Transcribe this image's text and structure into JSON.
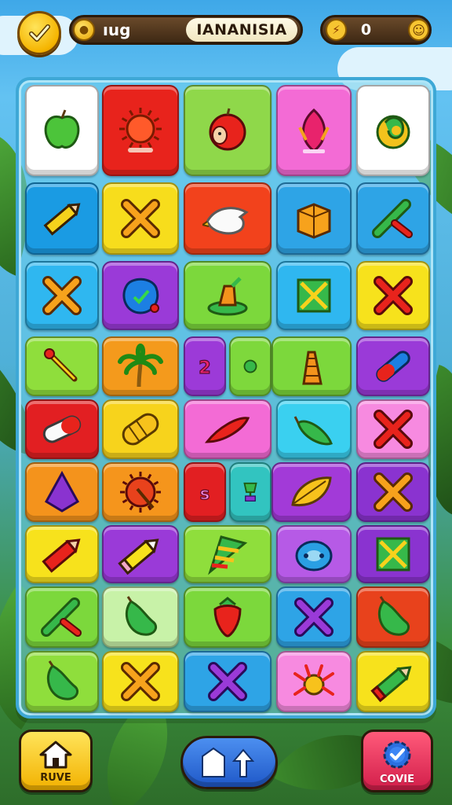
{
  "hud": {
    "level_text": "ıug",
    "title": "IANANISIA",
    "score": "0",
    "check_icon": "check-icon",
    "coin_icon": "coin-icon",
    "bolt_icon": "lightning-icon",
    "smile_icon": "smiley-icon"
  },
  "board": {
    "rows": [
      [
        {
          "icon": "green-apple",
          "color": "#ffffff"
        },
        {
          "icon": "red-sun-fruit",
          "color": "#e8231c"
        },
        {
          "icon": "red-apple-face",
          "color": "#8fd84a"
        },
        {
          "icon": "pink-leaf",
          "color": "#f36bd5"
        },
        {
          "icon": "green-yellow-fruit",
          "color": "#ffffff"
        }
      ],
      [
        {
          "icon": "yellow-pencil",
          "color": "#1a9be3"
        },
        {
          "icon": "orange-x",
          "color": "#f7dd1c"
        },
        {
          "icon": "white-bird",
          "color": "#f2421c"
        },
        {
          "icon": "orange-box",
          "color": "#2ea4e6"
        },
        {
          "icon": "green-red-pencil",
          "color": "#2ea4e6"
        }
      ],
      [
        {
          "icon": "orange-x",
          "color": "#2fb7f0"
        },
        {
          "icon": "blue-blob-check",
          "color": "#9a3ad8"
        },
        {
          "icon": "green-cup",
          "color": "#7cd83c"
        },
        {
          "icon": "green-x-square",
          "color": "#2fb7f0"
        },
        {
          "icon": "red-x",
          "color": "#f7e21c"
        }
      ],
      [
        {
          "icon": "matchstick",
          "color": "#8fde3c"
        },
        {
          "icon": "palm-tree",
          "color": "#f49a1c"
        },
        {
          "icon": "small-2",
          "color": "#9c3ad8",
          "small": true
        },
        {
          "icon": "green-dot",
          "color": "#7ed83c",
          "small": true
        },
        {
          "icon": "orange-cone",
          "color": "#7cd83c"
        },
        {
          "icon": "red-blue-capsule",
          "color": "#9a3ad8"
        }
      ],
      [
        {
          "icon": "white-capsule",
          "color": "#e21f22"
        },
        {
          "icon": "yellow-loaf",
          "color": "#f7d31c"
        },
        {
          "icon": "red-carrot",
          "color": "#f36bd5"
        },
        {
          "icon": "green-cucumber",
          "color": "#3ad0f0"
        },
        {
          "icon": "red-x",
          "color": "#f78ae0"
        }
      ],
      [
        {
          "icon": "purple-gem",
          "color": "#f4931c"
        },
        {
          "icon": "red-wheel",
          "color": "#f5951c"
        },
        {
          "icon": "pink-s",
          "color": "#e21f22",
          "small": true
        },
        {
          "icon": "green-trophy",
          "color": "#32c4c0",
          "small": true
        },
        {
          "icon": "yellow-leaf",
          "color": "#a23ad8"
        },
        {
          "icon": "orange-x",
          "color": "#8a33d0"
        }
      ],
      [
        {
          "icon": "red-pencil",
          "color": "#f7e21c"
        },
        {
          "icon": "white-pencil",
          "color": "#9a3ad8"
        },
        {
          "icon": "rainbow-wedge",
          "color": "#8fde3c"
        },
        {
          "icon": "blue-egg",
          "color": "#b65ae6"
        },
        {
          "icon": "green-x-square",
          "color": "#8a33d0"
        }
      ],
      [
        {
          "icon": "green-red-pencil",
          "color": "#7cd83c"
        },
        {
          "icon": "green-pepper",
          "color": "#c8f2a8"
        },
        {
          "icon": "red-strawberry",
          "color": "#7cd83c"
        },
        {
          "icon": "purple-x",
          "color": "#2ea4e6"
        },
        {
          "icon": "green-pepper",
          "color": "#e8421c"
        }
      ],
      [
        {
          "icon": "green-pepper",
          "color": "#8fde3c"
        },
        {
          "icon": "orange-x",
          "color": "#f7e21c"
        },
        {
          "icon": "purple-x",
          "color": "#2ea4e6"
        },
        {
          "icon": "pink-bug",
          "color": "#f78ae0"
        },
        {
          "icon": "green-pencil",
          "color": "#f7e21c"
        }
      ]
    ]
  },
  "buttons": {
    "home": {
      "label": "RUVE",
      "icon": "home-icon"
    },
    "move": {
      "label": "",
      "icon": "arrows-icon"
    },
    "cove": {
      "label": "COVIE",
      "icon": "gear-check-icon"
    }
  }
}
